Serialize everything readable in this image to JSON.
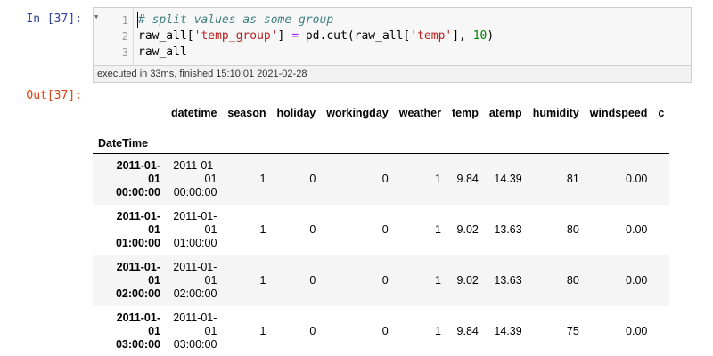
{
  "input_cell": {
    "prompt": "In [37]:",
    "line_numbers": [
      "1",
      "2",
      "3"
    ],
    "line1_comment": "# split values as some group",
    "line2": {
      "a": "raw_all[",
      "str1": "'temp_group'",
      "b": "] ",
      "eq": "=",
      "c": " pd.cut(raw_all[",
      "str2": "'temp'",
      "d": "], ",
      "num": "10",
      "e": ")"
    },
    "line3": "raw_all",
    "exec_info": "executed in 33ms, finished 15:10:01 2021-02-28"
  },
  "output_cell": {
    "prompt": "Out[37]:",
    "index_name": "DateTime",
    "columns": [
      "datetime",
      "season",
      "holiday",
      "workingday",
      "weather",
      "temp",
      "atemp",
      "humidity",
      "windspeed",
      "c"
    ],
    "rows": [
      {
        "index": [
          "2011-01-",
          "01",
          "00:00:00"
        ],
        "datetime": [
          "2011-01-",
          "01",
          "00:00:00"
        ],
        "season": "1",
        "holiday": "0",
        "workingday": "0",
        "weather": "1",
        "temp": "9.84",
        "atemp": "14.39",
        "humidity": "81",
        "windspeed": "0.00"
      },
      {
        "index": [
          "2011-01-",
          "01",
          "01:00:00"
        ],
        "datetime": [
          "2011-01-",
          "01",
          "01:00:00"
        ],
        "season": "1",
        "holiday": "0",
        "workingday": "0",
        "weather": "1",
        "temp": "9.02",
        "atemp": "13.63",
        "humidity": "80",
        "windspeed": "0.00"
      },
      {
        "index": [
          "2011-01-",
          "01",
          "02:00:00"
        ],
        "datetime": [
          "2011-01-",
          "01",
          "02:00:00"
        ],
        "season": "1",
        "holiday": "0",
        "workingday": "0",
        "weather": "1",
        "temp": "9.02",
        "atemp": "13.63",
        "humidity": "80",
        "windspeed": "0.00"
      },
      {
        "index": [
          "2011-01-",
          "01",
          "03:00:00"
        ],
        "datetime": [
          "2011-01-",
          "01",
          "03:00:00"
        ],
        "season": "1",
        "holiday": "0",
        "workingday": "0",
        "weather": "1",
        "temp": "9.84",
        "atemp": "14.39",
        "humidity": "75",
        "windspeed": "0.00"
      }
    ]
  },
  "colors": {
    "in_prompt": "#303f9f",
    "out_prompt": "#d84315",
    "comment": "#408080",
    "string": "#ba2121",
    "number": "#008000",
    "row_stripe": "#f5f5f5"
  },
  "icons": {
    "fold": "fold-triangle-icon"
  }
}
